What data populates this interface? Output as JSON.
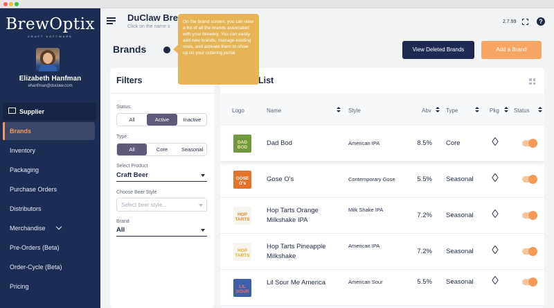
{
  "app": {
    "logo_text": "BrewOptix",
    "logo_tagline": "CRAFT SOFTWARE",
    "version": "2.7.99"
  },
  "user": {
    "name": "Elizabeth Hanfman",
    "email": "ehanfman@duclaw.com"
  },
  "sidebar": {
    "section_label": "Supplier",
    "items": [
      {
        "label": "Brands",
        "active": true
      },
      {
        "label": "Inventory"
      },
      {
        "label": "Packaging"
      },
      {
        "label": "Purchase Orders"
      },
      {
        "label": "Distributors"
      },
      {
        "label": "Merchandise",
        "has_chevron": true
      },
      {
        "label": "Pre-Orders (Beta)"
      },
      {
        "label": "Order-Cycle (Beta)"
      },
      {
        "label": "Pricing"
      }
    ]
  },
  "header": {
    "title": "DuClaw Brew",
    "subtitle": "Click on the name s"
  },
  "page": {
    "title": "Brands",
    "view_deleted_label": "View Deleted Brands",
    "add_brand_label": "Add a Brand"
  },
  "tooltip": {
    "text": "On the brand screen, you can view a list of all the brands associated with your brewery. You can easily add new brands, manage existing ones, and activate them to show up on your ordering portal."
  },
  "filters": {
    "title": "Filters",
    "status": {
      "label": "Status:",
      "options": [
        "All",
        "Active",
        "Inactive"
      ],
      "selected": "Active"
    },
    "type": {
      "label": "Type:",
      "options": [
        "All",
        "Core",
        "Seasonal"
      ],
      "selected": "All"
    },
    "product": {
      "label": "Select Product",
      "value": "Craft Beer"
    },
    "beer_style": {
      "label": "Choose Beer Style",
      "placeholder": "Select beer style..."
    },
    "brand": {
      "label": "Brand",
      "value": "All"
    }
  },
  "list": {
    "title": "List",
    "columns": {
      "logo": "Logo",
      "name": "Name",
      "style": "Style",
      "abv": "Abv",
      "type": "Type",
      "pkg": "Pkg",
      "status": "Status"
    },
    "rows": [
      {
        "thumb_text": "DAD BOD",
        "thumb_bg": "#6e9a3c",
        "thumb_fg": "#f3e6a2",
        "name": "Dad Bod",
        "style": "American IPA",
        "abv": "8.5%",
        "type": "Core",
        "status_on": true
      },
      {
        "thumb_text": "GOSE O's",
        "thumb_bg": "#e4732c",
        "thumb_fg": "#ffffff",
        "name": "Gose O's",
        "style": "Contemporary Gose",
        "abv": "5.5%",
        "type": "Seasonal",
        "status_on": true
      },
      {
        "thumb_text": "HOP TARTS",
        "thumb_bg": "#f7f4ee",
        "thumb_fg": "#e08a2a",
        "name": "Hop Tarts Orange Milkshake IPA",
        "style": "Milk Shake IPA",
        "abv": "7.2%",
        "type": "Seasonal",
        "status_on": true
      },
      {
        "thumb_text": "HOP TARTS",
        "thumb_bg": "#f7f4ee",
        "thumb_fg": "#e0b22a",
        "name": "Hop Tarts Pineapple Milkshake",
        "style": "American IPA",
        "abv": "7.2%",
        "type": "Seasonal",
        "status_on": true
      },
      {
        "thumb_text": "LIL SOUR",
        "thumb_bg": "#3d5fa8",
        "thumb_fg": "#f26b6b",
        "name": "Lil Sour Me America",
        "style": "American Sour",
        "abv": "5.5%",
        "type": "Seasonal",
        "status_on": true
      }
    ]
  },
  "colors": {
    "sidebar_bg": "#1d2c52",
    "accent_orange": "#f59a55",
    "tooltip_bg": "#e7b558",
    "navy_button": "#1e2a52"
  }
}
